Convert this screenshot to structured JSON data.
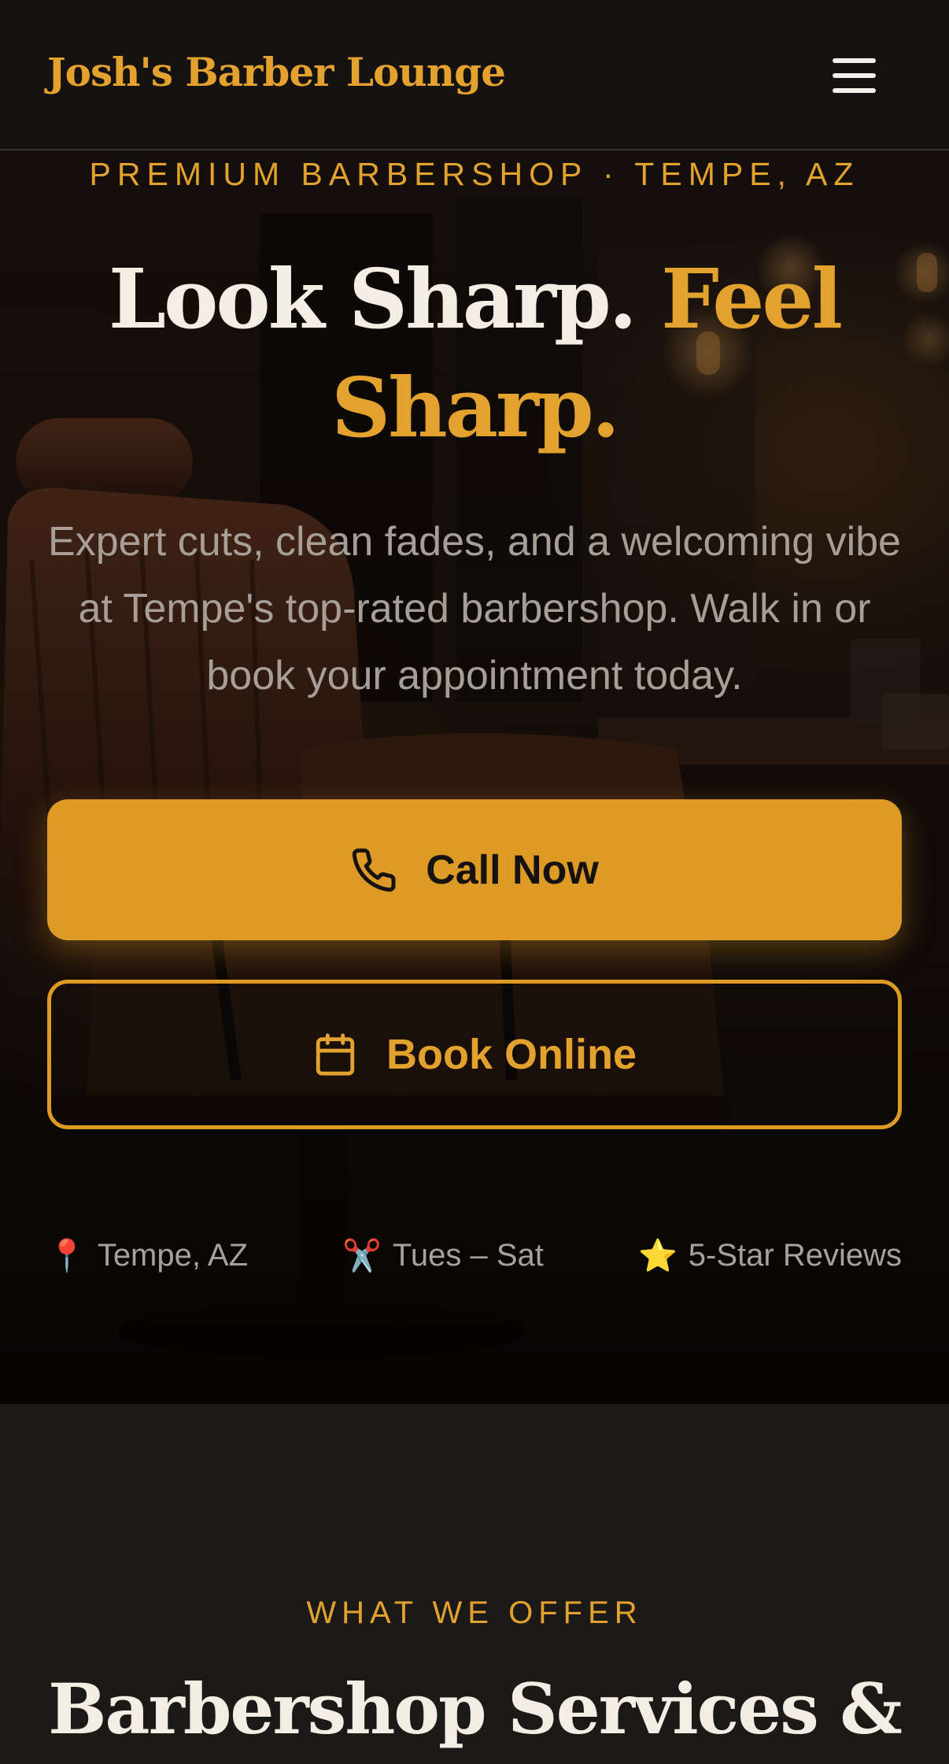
{
  "header": {
    "logo": "Josh's Barber Lounge",
    "menu_icon": "hamburger-menu-icon"
  },
  "hero": {
    "eyebrow": "PREMIUM BARBERSHOP · TEMPE, AZ",
    "title_part1": "Look Sharp. ",
    "title_part2": "Feel Sharp.",
    "subtitle": "Expert cuts, clean fades, and a welcoming vibe at Tempe's top-rated barbershop. Walk in or book your appointment today.",
    "call_button": {
      "label": "Call Now",
      "icon": "phone-icon"
    },
    "book_button": {
      "label": "Book Online",
      "icon": "calendar-icon"
    },
    "meta": [
      {
        "icon": "📍",
        "text": "Tempe, AZ"
      },
      {
        "icon": "✂️",
        "text": "Tues – Sat"
      },
      {
        "icon": "⭐",
        "text": "5-Star Reviews"
      }
    ]
  },
  "services": {
    "eyebrow": "WHAT WE OFFER",
    "title": "Barbershop Services &"
  },
  "colors": {
    "accent": "#e3a12d",
    "button": "#dd9a24",
    "header_bg": "#151211",
    "page_bg": "#1c1a19",
    "text_light": "#f3ede4",
    "text_muted": "#a69e97"
  }
}
